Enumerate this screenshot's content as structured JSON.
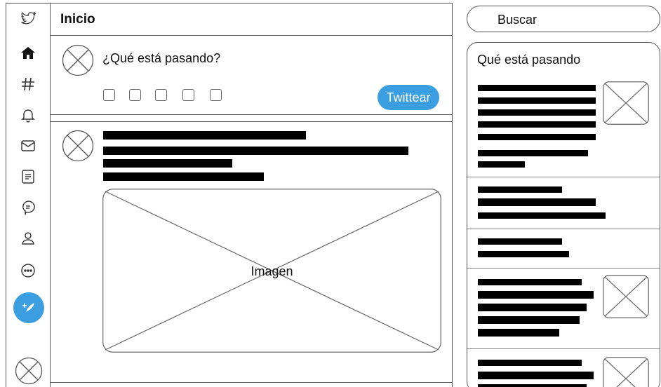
{
  "header": {
    "title": "Inicio"
  },
  "composer": {
    "prompt": "¿Qué está pasando?",
    "tweet_button": "Twittear",
    "tool_count": 5
  },
  "tweet": {
    "media_label": "Imagen"
  },
  "search": {
    "label": "Buscar"
  },
  "trends": {
    "title": "Qué está pasando"
  },
  "nav": {
    "icons": [
      "twitter-bird-icon",
      "home-icon",
      "hashtag-icon",
      "bell-icon",
      "mail-icon",
      "list-icon",
      "chat-icon",
      "profile-icon",
      "more-icon"
    ]
  },
  "colors": {
    "accent": "#3a9ee0",
    "text": "#111111",
    "border": "#555555"
  }
}
